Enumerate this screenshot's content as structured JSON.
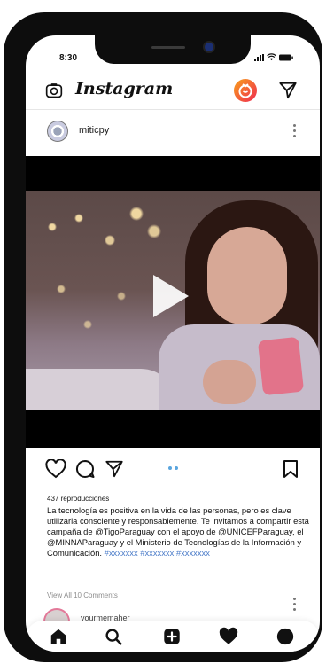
{
  "status_bar": {
    "time": "8:30"
  },
  "header": {
    "app_name": "Instagram"
  },
  "post": {
    "username": "miticpy",
    "views": "437 reproducciones",
    "caption": "La tecnología es positiva en la vida de las personas, pero es clave utilizarla consciente y responsablemente. Te invitamos a compartir esta campaña de @TigoParaguay con el apoyo de @UNICEFParaguay, el @MINNAParaguay y el Ministerio de Tecnologías de la Información y Comunicación.",
    "hashtags": "#xxxxxxx #xxxxxxx #xxxxxxx",
    "comments_link": "View All 10 Comments",
    "comment_preview_user": "yourmemaher"
  },
  "colors": {
    "hashtag": "#4b7cc9",
    "pager_dot": "#5aa5de",
    "igtv_gradient_start": "#f8a11b",
    "igtv_gradient_end": "#ef2a52"
  },
  "icons": {
    "header": [
      "camera-icon",
      "igtv-icon",
      "direct-send-icon"
    ],
    "actions": [
      "heart-outline-icon",
      "comment-icon",
      "share-icon",
      "bookmark-icon"
    ],
    "bottom_nav": [
      "home-icon",
      "search-icon",
      "add-post-icon",
      "activity-heart-icon",
      "profile-icon"
    ]
  }
}
